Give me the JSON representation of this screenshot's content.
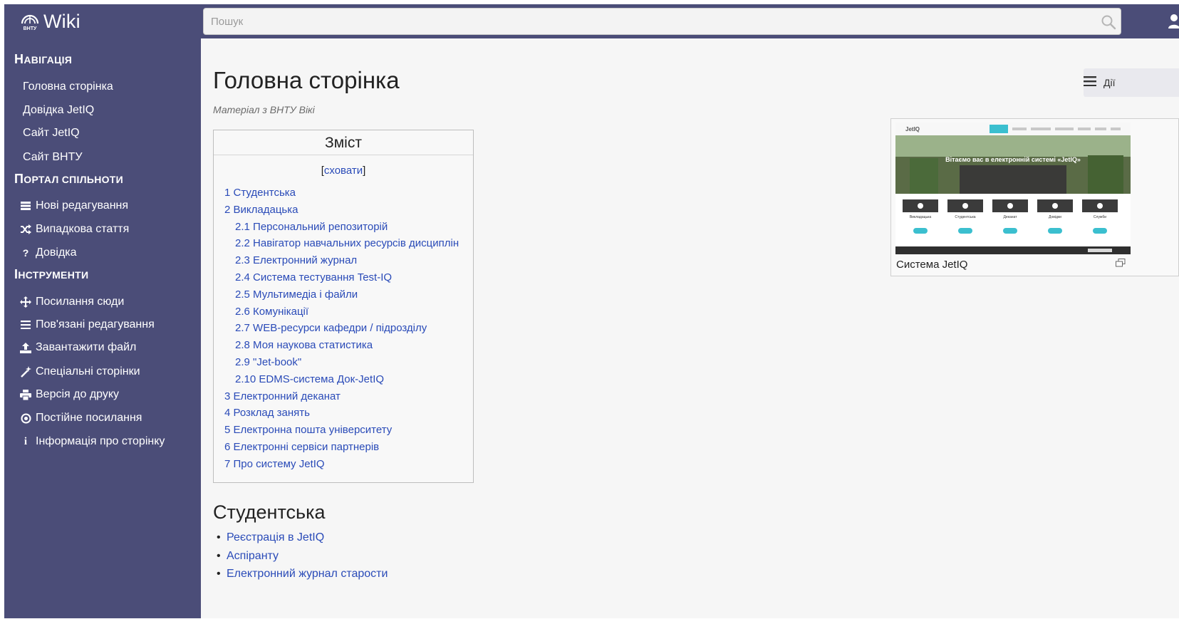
{
  "header": {
    "logo_text": "Wiki",
    "logo_badge": "ВНТУ",
    "search_placeholder": "Пошук",
    "brand_color": "#4b4d78"
  },
  "sidebar": {
    "sections": [
      {
        "heading_cap": "Н",
        "heading_rest": "авігація",
        "items": [
          {
            "label": "Головна сторінка",
            "icon": ""
          },
          {
            "label": "Довідка JetIQ",
            "icon": ""
          },
          {
            "label": "Сайт JetIQ",
            "icon": ""
          },
          {
            "label": "Сайт ВНТУ",
            "icon": ""
          }
        ]
      },
      {
        "heading_cap": "П",
        "heading_rest": "ортал спільноти",
        "items": [
          {
            "label": "Нові редагування",
            "icon": "list-icon"
          },
          {
            "label": "Випадкова стаття",
            "icon": "shuffle-icon"
          },
          {
            "label": "Довідка",
            "icon": "question-icon"
          }
        ]
      },
      {
        "heading_cap": "І",
        "heading_rest": "нструменти",
        "items": [
          {
            "label": "Посилання сюди",
            "icon": "move-icon"
          },
          {
            "label": "Пов'язані редагування",
            "icon": "hamburger-icon"
          },
          {
            "label": "Завантажити файл",
            "icon": "upload-icon"
          },
          {
            "label": "Спеціальні сторінки",
            "icon": "wand-icon"
          },
          {
            "label": "Версія до друку",
            "icon": "print-icon"
          },
          {
            "label": "Постійне посилання",
            "icon": "target-icon"
          },
          {
            "label": "Інформація про сторінку",
            "icon": "info-icon"
          }
        ]
      }
    ]
  },
  "main": {
    "title": "Головна сторінка",
    "subtitle": "Матеріал з ВНТУ Вікі",
    "actions_label": "Дії",
    "toc": {
      "title": "Зміст",
      "toggle_label": "сховати",
      "items": [
        {
          "num": "1",
          "text": "Студентська",
          "level": 1
        },
        {
          "num": "2",
          "text": "Викладацька",
          "level": 1
        },
        {
          "num": "2.1",
          "text": "Персональний репозиторій",
          "level": 2
        },
        {
          "num": "2.2",
          "text": "Навігатор навчальних ресурсів дисциплін",
          "level": 2
        },
        {
          "num": "2.3",
          "text": "Електронний журнал",
          "level": 2
        },
        {
          "num": "2.4",
          "text": "Система тестування Test-IQ",
          "level": 2
        },
        {
          "num": "2.5",
          "text": "Мультимедіа і файли",
          "level": 2
        },
        {
          "num": "2.6",
          "text": "Комунікації",
          "level": 2
        },
        {
          "num": "2.7",
          "text": "WEB-ресурси кафедри / підрозділу",
          "level": 2
        },
        {
          "num": "2.8",
          "text": "Моя наукова статистика",
          "level": 2
        },
        {
          "num": "2.9",
          "text": "\"Jet-book\"",
          "level": 2
        },
        {
          "num": "2.10",
          "text": "EDMS-система Док-JetIQ",
          "level": 2
        },
        {
          "num": "3",
          "text": "Електронний деканат",
          "level": 1
        },
        {
          "num": "4",
          "text": "Розклад занять",
          "level": 1
        },
        {
          "num": "5",
          "text": "Електронна пошта університету",
          "level": 1
        },
        {
          "num": "6",
          "text": "Електронні сервіси партнерів",
          "level": 1
        },
        {
          "num": "7",
          "text": "Про систему JetIQ",
          "level": 1
        }
      ]
    },
    "section_heading": "Студентська",
    "bullets": [
      "Реєстрація в JetIQ",
      "Аспіранту",
      "Електронний журнал старости"
    ],
    "thumbnail": {
      "caption": "Система JetIQ",
      "mini_logo": "JetIQ",
      "banner_text": "Вітаємо вас в електронній системі «JetIQ»",
      "cards": [
        "Викладацька",
        "Студентська",
        "Деканат",
        "Довідки",
        "Служби"
      ]
    }
  }
}
